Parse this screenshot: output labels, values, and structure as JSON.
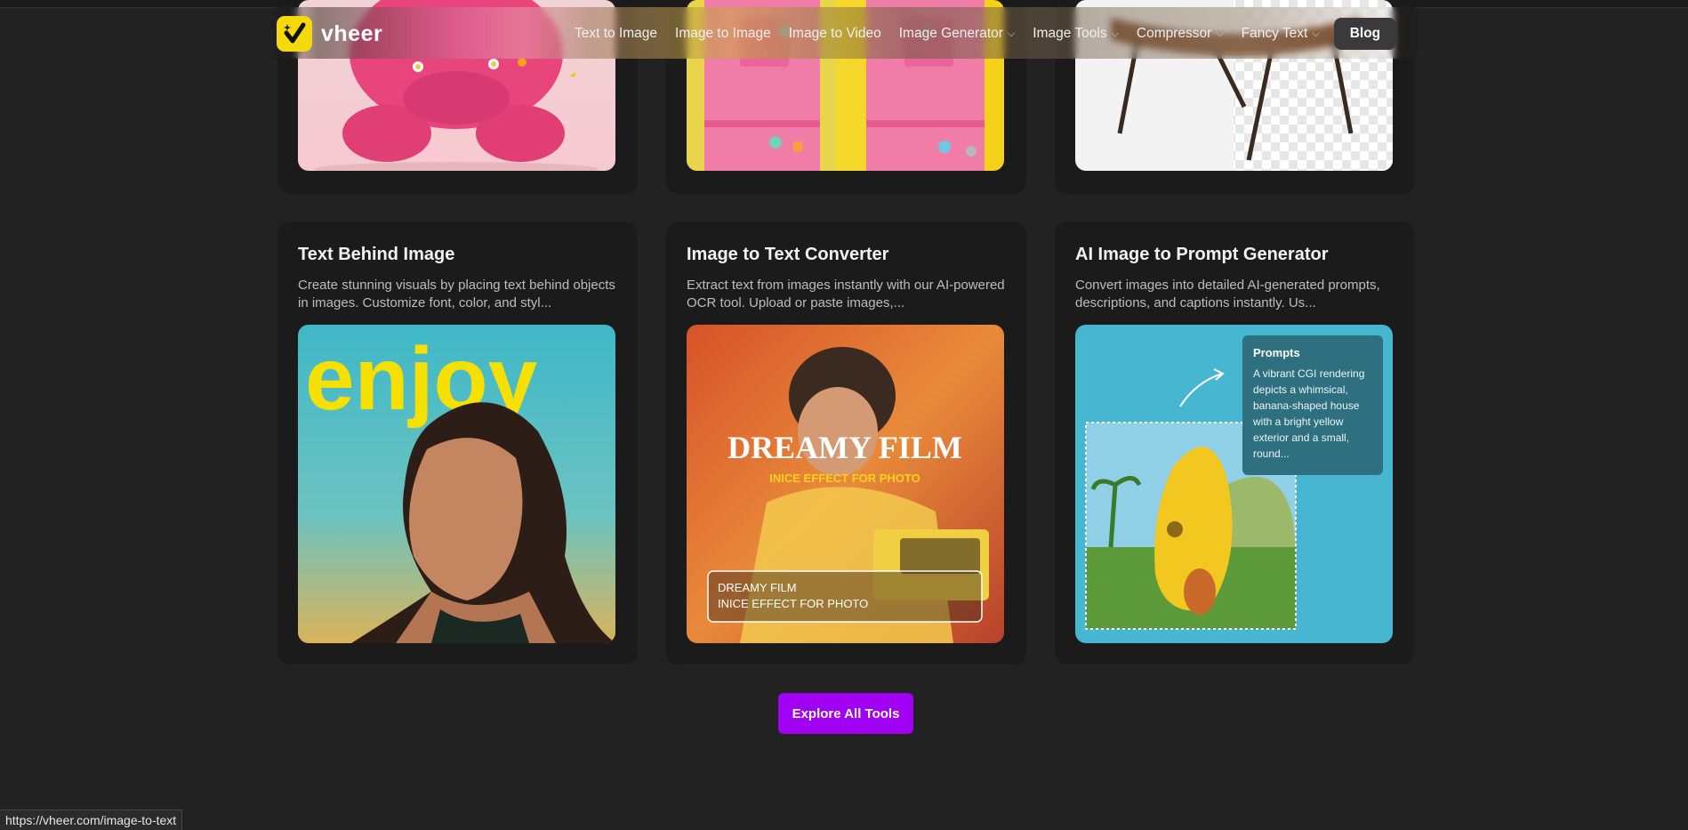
{
  "brand": {
    "name": "vheer",
    "accent": "#f5d90a"
  },
  "nav": {
    "items": [
      {
        "label": "Text to Image",
        "dropdown": false
      },
      {
        "label": "Image to Image",
        "dropdown": false
      },
      {
        "label": "Image to Video",
        "dropdown": false
      },
      {
        "label": "Image Generator",
        "dropdown": true
      },
      {
        "label": "Image Tools",
        "dropdown": true
      },
      {
        "label": "Compressor",
        "dropdown": true
      },
      {
        "label": "Fancy Text",
        "dropdown": true
      }
    ],
    "blog_label": "Blog"
  },
  "tools": [
    {
      "title": "Text Behind Image",
      "description": "Create stunning visuals by placing text behind objects in images. Customize font, color, and styl...",
      "image_text": "enjoy"
    },
    {
      "title": "Image to Text Converter",
      "description": "Extract text from images instantly with our AI-powered OCR tool. Upload or paste images,...",
      "image_headline": "DREAMY FILM",
      "image_subheadline": "INICE EFFECT FOR PHOTO",
      "ocr_line1": "DREAMY FILM",
      "ocr_line2": "INICE EFFECT FOR PHOTO"
    },
    {
      "title": "AI Image to Prompt Generator",
      "description": "Convert images into detailed AI-generated prompts, descriptions, and captions instantly. Us...",
      "prompt_title": "Prompts",
      "prompt_text": "A vibrant CGI rendering depicts a whimsical, banana-shaped house with a bright yellow exterior and a small, round..."
    }
  ],
  "explore_label": "Explore All Tools",
  "explore_color": "#a100f2",
  "status_url": "https://vheer.com/image-to-text"
}
